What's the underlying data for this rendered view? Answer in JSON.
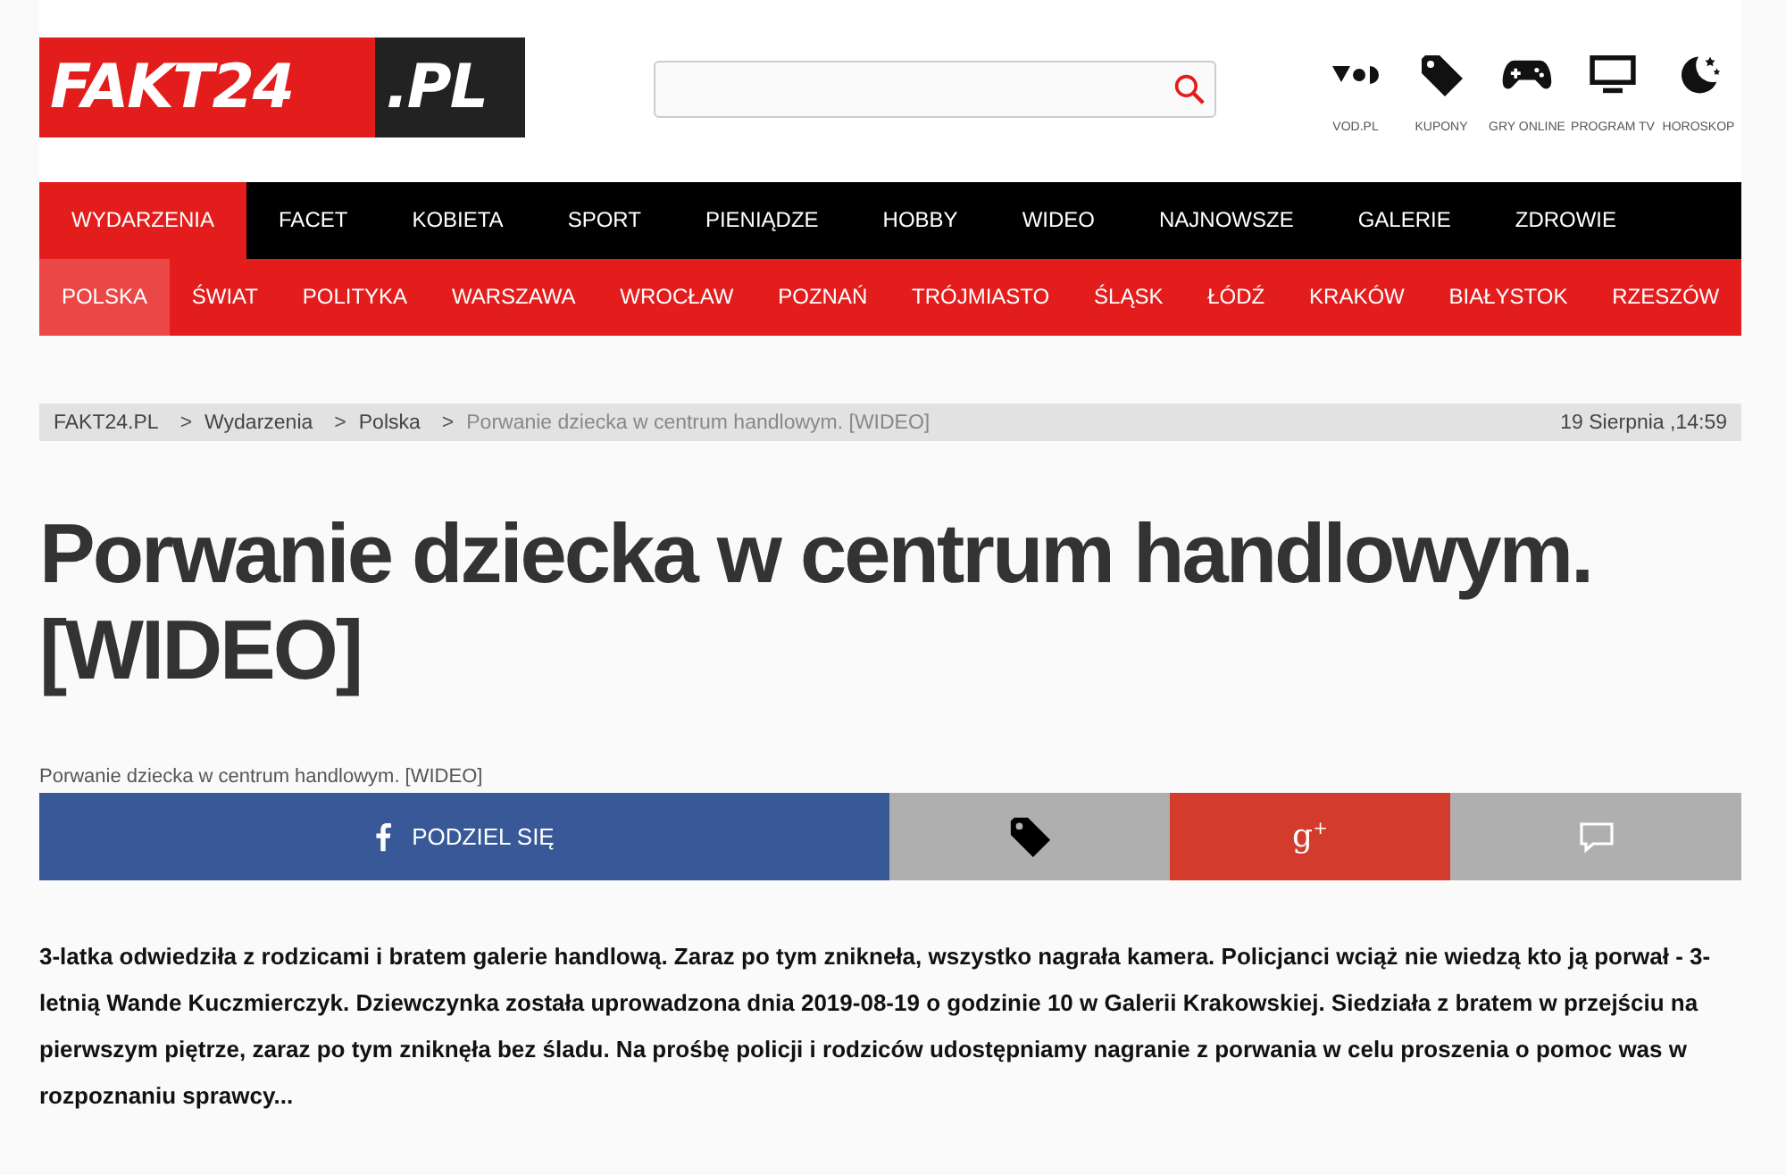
{
  "logo": {
    "main": "FAKT24",
    "suffix": ".PL"
  },
  "services": [
    {
      "kind": "vod",
      "label": "VOD.PL"
    },
    {
      "kind": "tag",
      "label": "KUPONY"
    },
    {
      "kind": "gamepad",
      "label": "GRY ONLINE"
    },
    {
      "kind": "tv",
      "label": "PROGRAM TV"
    },
    {
      "kind": "moon",
      "label": "HOROSKOP"
    }
  ],
  "main_nav": [
    {
      "label": "WYDARZENIA",
      "selected": true
    },
    {
      "label": "FACET",
      "selected": false
    },
    {
      "label": "KOBIETA",
      "selected": false
    },
    {
      "label": "SPORT",
      "selected": false
    },
    {
      "label": "PIENIĄDZE",
      "selected": false
    },
    {
      "label": "HOBBY",
      "selected": false
    },
    {
      "label": "WIDEO",
      "selected": false
    },
    {
      "label": "NAJNOWSZE",
      "selected": false
    },
    {
      "label": "GALERIE",
      "selected": false
    },
    {
      "label": "ZDROWIE",
      "selected": false
    }
  ],
  "sub_nav": [
    {
      "label": "POLSKA",
      "selected": true
    },
    {
      "label": "ŚWIAT",
      "selected": false
    },
    {
      "label": "POLITYKA",
      "selected": false
    },
    {
      "label": "WARSZAWA",
      "selected": false
    },
    {
      "label": "WROCŁAW",
      "selected": false
    },
    {
      "label": "POZNAŃ",
      "selected": false
    },
    {
      "label": "TRÓJMIASTO",
      "selected": false
    },
    {
      "label": "ŚLĄSK",
      "selected": false
    },
    {
      "label": "ŁÓDŹ",
      "selected": false
    },
    {
      "label": "KRAKÓW",
      "selected": false
    },
    {
      "label": "BIAŁYSTOK",
      "selected": false
    },
    {
      "label": "RZESZÓW",
      "selected": false
    }
  ],
  "breadcrumb": {
    "items": [
      {
        "label": "FAKT24.PL",
        "current": false
      },
      {
        "label": "Wydarzenia",
        "current": false
      },
      {
        "label": "Polska",
        "current": false
      },
      {
        "label": "Porwanie dziecka w centrum handlowym. [WIDEO]",
        "current": true
      }
    ],
    "separator": ">",
    "date": "19 Sierpnia ,14:59"
  },
  "headline": "Porwanie dziecka w centrum handlowym. [WIDEO]",
  "caption": "Porwanie dziecka w centrum handlowym. [WIDEO]",
  "share": [
    {
      "kind": "facebook",
      "label": "PODZIEL SIĘ",
      "color": "#385898"
    },
    {
      "kind": "tag",
      "color": "#afafaf"
    },
    {
      "kind": "gplus",
      "label": "g$^{+}$",
      "color": "#d33b2c"
    },
    {
      "kind": "comment",
      "color": "#afafaf"
    }
  ],
  "lead": "3-latka odwiedziła z rodzicami i bratem galerie handlową. Zaraz po tym znikneła, wszystko nagrała kamera. Policjanci wciąż nie wiedzą kto ją porwał - 3-letnią Wande Kuczmierczyk. Dziewczynka została uprowadzona dnia 2019-08-19 o godzinie 10 w Galerii Krakowskiej. Siedziała z bratem w przejściu na pierwszym piętrze, zaraz po tym zniknęła bez śladu. Na prośbę policji i rodziców udostępniamy nagranie z porwania w celu proszenia o pomoc was w rozpoznaniu sprawcy..."
}
